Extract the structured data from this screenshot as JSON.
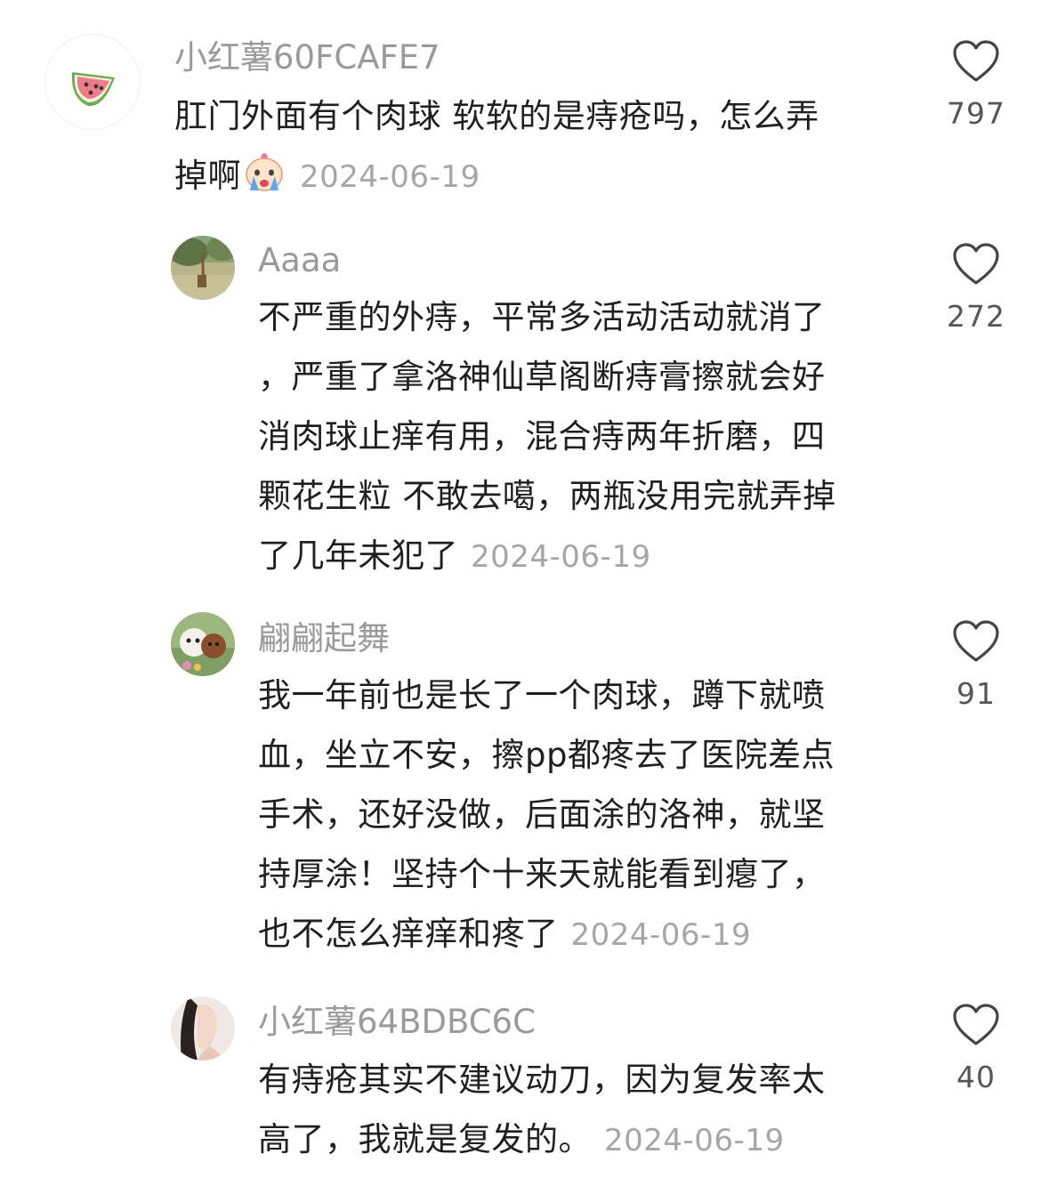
{
  "comments": [
    {
      "username": "小红薯60FCAFE7",
      "avatar_icon": "watermelon-icon",
      "lines": [
        "肛门外面有个肉球 软软的是痔疮吗，怎么弄",
        "掉啊"
      ],
      "emoji": "crying-face-icon",
      "date": "2024-06-19",
      "likes": "797"
    },
    {
      "username": "Aaaa",
      "avatar_icon": "giraffe-photo-avatar",
      "lines": [
        "不严重的外痔，平常多活动活动就消了",
        "，严重了拿洛神仙草阁断痔膏擦就会好",
        "消肉球止痒有用，混合痔两年折磨，四",
        "颗花生粒 不敢去噶，两瓶没用完就弄掉",
        "了几年未犯了"
      ],
      "date": "2024-06-19",
      "likes": "272"
    },
    {
      "username": "翩翩起舞",
      "avatar_icon": "dogs-photo-avatar",
      "lines": [
        "我一年前也是长了一个肉球，蹲下就喷",
        "血，坐立不安，擦pp都疼去了医院差点",
        "手术，还好没做，后面涂的洛神，就坚",
        "持厚涂！坚持个十来天就能看到瘪了，",
        "也不怎么痒痒和疼了"
      ],
      "date": "2024-06-19",
      "likes": "91"
    },
    {
      "username": "小红薯64BDBC6C",
      "avatar_icon": "woman-photo-avatar",
      "lines": [
        "有痔疮其实不建议动刀，因为复发率太",
        "高了，我就是复发的。"
      ],
      "date": "2024-06-19",
      "likes": "40"
    }
  ]
}
